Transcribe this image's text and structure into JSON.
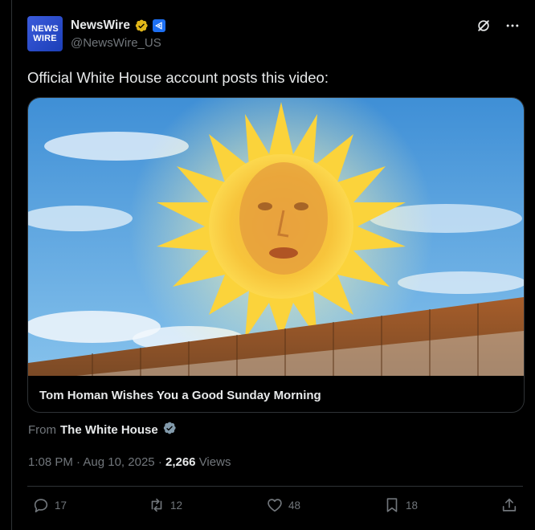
{
  "account": {
    "avatar_line1": "NEWS",
    "avatar_line2": "WIRE",
    "name": "NewsWire",
    "handle": "@NewsWire_US"
  },
  "tweet": {
    "text": "Official White House account posts this video:"
  },
  "card": {
    "title": "Tom Homan Wishes You a Good Sunday Morning"
  },
  "source": {
    "prefix": "From",
    "name": "The White House"
  },
  "meta": {
    "time": "1:08 PM",
    "sep1": "·",
    "date": "Aug 10, 2025",
    "sep2": "·",
    "views": "2,266",
    "views_label": "Views"
  },
  "actions": {
    "replies": "17",
    "reposts": "12",
    "likes": "48",
    "bookmarks": "18"
  },
  "colors": {
    "background": "#000000",
    "text": "#e7e9ea",
    "muted": "#71767b",
    "verified_gold": "#e2b719",
    "verified_gray": "#829aab"
  }
}
